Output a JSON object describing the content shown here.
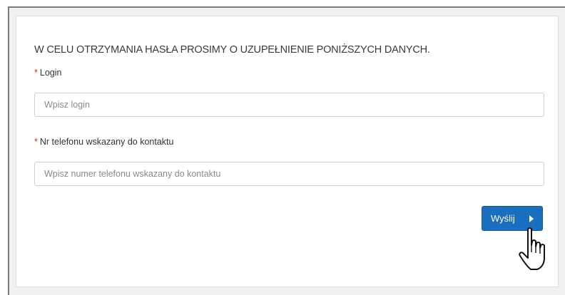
{
  "form": {
    "heading": "W CELU OTRZYMANIA HASŁA PROSIMY O UZUPEŁNIENIE PONIŻSZYCH DANYCH.",
    "required_marker": "*",
    "login": {
      "label": "Login",
      "value": "",
      "placeholder": "Wpisz login"
    },
    "phone": {
      "label": "Nr telefonu wskazany do kontaktu",
      "value": "",
      "placeholder": "Wpisz numer telefonu wskazany do kontaktu"
    },
    "submit": {
      "label": "Wyślij",
      "icon": "play-arrow-icon"
    }
  },
  "cursor": {
    "icon": "hand-pointer-icon"
  },
  "colors": {
    "button": "#1a6ec0",
    "required": "#d9261c",
    "background": "#f1f1f1"
  }
}
